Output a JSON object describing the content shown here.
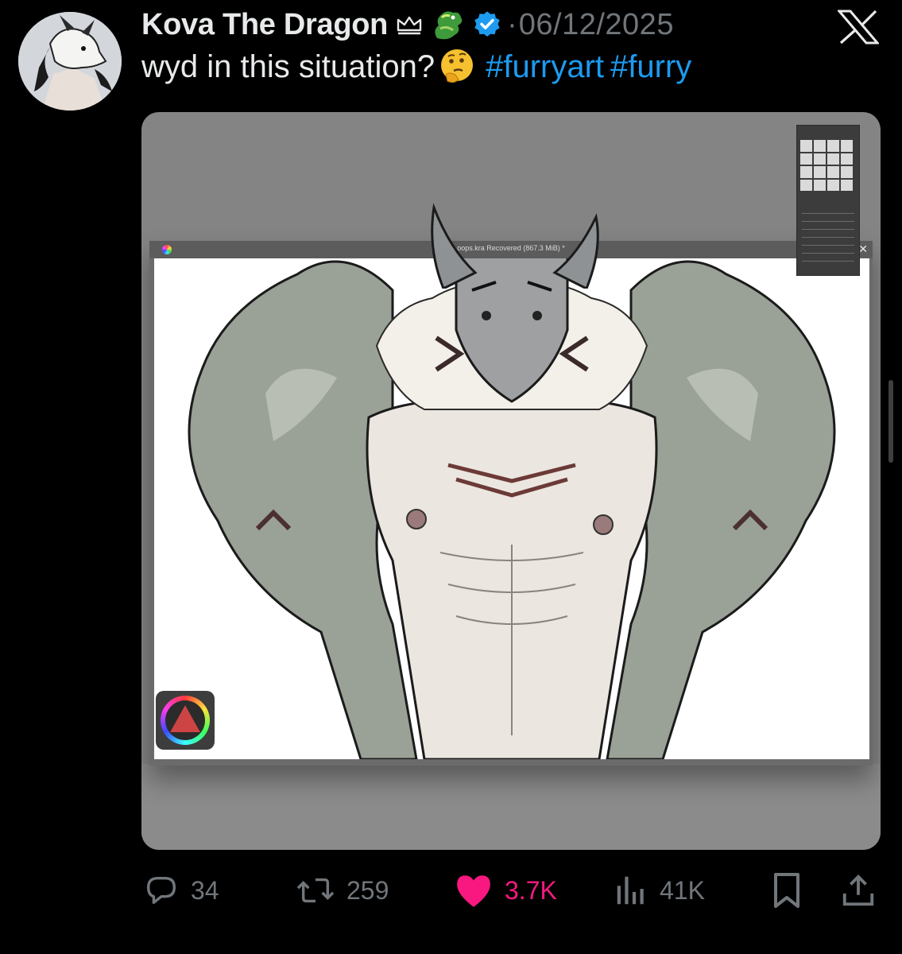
{
  "post": {
    "author_name": "Kova The Dragon",
    "date": "06/12/2025",
    "separator": "·",
    "text": "wyd in this situation?",
    "hashtags": [
      "#furryart",
      "#furry"
    ]
  },
  "media": {
    "window_title": "oops.kra Recovered (867.3 MiB) *",
    "close_glyph": "✕"
  },
  "actions": {
    "replies": "34",
    "reposts": "259",
    "likes": "3.7K",
    "views": "41K"
  },
  "icons": {
    "crown": "crown-icon",
    "dragon_emoji": "dragon-emoji-icon",
    "verified": "verified-badge-icon",
    "x_logo": "x-logo-icon",
    "thinking_emoji": "thinking-face-emoji-icon",
    "reply": "reply-icon",
    "repost": "repost-icon",
    "like": "heart-icon",
    "views": "views-chart-icon",
    "bookmark": "bookmark-icon",
    "share": "share-icon"
  },
  "colors": {
    "background": "#000000",
    "text": "#e7e9ea",
    "muted": "#71767b",
    "link": "#1d9bf0",
    "like": "#f91880",
    "verified": "#1d9bf0"
  }
}
